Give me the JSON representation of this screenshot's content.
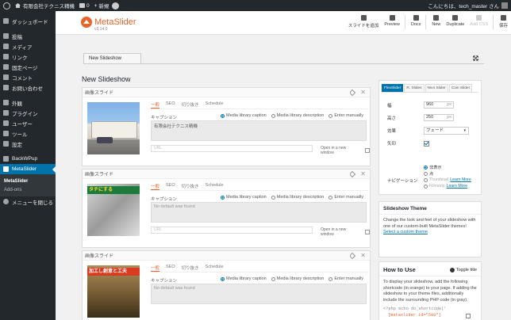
{
  "adminbar": {
    "site_name": "有限会社テクニス精機",
    "comments_count": "0",
    "new_label": "新規",
    "greeting": "こんにちは、tech_master さん"
  },
  "sidebar": {
    "items": [
      {
        "label": "ダッシュボード",
        "icon": "dashboard-icon"
      },
      {
        "label": "投稿",
        "icon": "pushpin-icon"
      },
      {
        "label": "メディア",
        "icon": "media-icon"
      },
      {
        "label": "リンク",
        "icon": "link-icon"
      },
      {
        "label": "固定ページ",
        "icon": "page-icon"
      },
      {
        "label": "コメント",
        "icon": "comment-icon"
      },
      {
        "label": "お問い合わせ",
        "icon": "mail-icon"
      },
      {
        "label": "外観",
        "icon": "brush-icon"
      },
      {
        "label": "プラグイン",
        "icon": "plugin-icon"
      },
      {
        "label": "ユーザー",
        "icon": "user-icon"
      },
      {
        "label": "ツール",
        "icon": "wrench-icon"
      },
      {
        "label": "設定",
        "icon": "settings-icon"
      },
      {
        "label": "BackWPup",
        "icon": "backup-icon"
      },
      {
        "label": "MetaSlider",
        "icon": "slider-icon"
      }
    ],
    "submenu": [
      "MetaSlider",
      "Add-ons"
    ],
    "collapse_label": "メニューを閉じる"
  },
  "header": {
    "logo_name": "MetaSlider",
    "version": "v3.14.0",
    "toolbar": [
      {
        "label": "スライドを追加",
        "icon": "plus-icon"
      },
      {
        "label": "Preview",
        "icon": "eye-icon"
      },
      {
        "label": "Docs",
        "icon": "docs-icon"
      },
      {
        "label": "New",
        "icon": "new-icon"
      },
      {
        "label": "Duplicate",
        "icon": "duplicate-icon"
      },
      {
        "label": "Add CSS",
        "icon": "css-icon"
      },
      {
        "label": "保存",
        "icon": "save-icon"
      }
    ]
  },
  "main": {
    "tab_label": "New Slideshow",
    "page_title": "New Slideshow",
    "slide_tabs": [
      "一般",
      "SEO",
      "切り抜き",
      "Schedule"
    ],
    "caption_label": "キャプション",
    "caption_options": [
      "Media library caption",
      "Media library description",
      "Enter manually"
    ],
    "url_placeholder": "URL",
    "new_window_label": "Open in a new window",
    "slides": [
      {
        "title": "画像スライド",
        "caption": "有限会社テクニス精機",
        "overlay": ""
      },
      {
        "title": "画像スライド",
        "caption": "No default was found",
        "overlay": "タチにする"
      },
      {
        "title": "画像スライド",
        "caption": "No default was found",
        "overlay": "加工し創意と工夫"
      }
    ]
  },
  "settings": {
    "tabs": [
      "FlexSlider",
      "R. Slides",
      "Nivo Slider",
      "Coin Slider"
    ],
    "width_label": "幅",
    "width_value": "960",
    "height_label": "高さ",
    "height_value": "250",
    "unit": "px",
    "effect_label": "効果",
    "effect_value": "フェード",
    "arrows_label": "矢印",
    "navigation_label": "ナビゲーション",
    "nav_options": [
      "非表示",
      "点",
      "Thumbnail",
      "Filmstrip"
    ],
    "learn_more": "Learn More"
  },
  "theme_panel": {
    "title": "Slideshow Theme",
    "body": "Change the look and feel of your slideshow with one of our custom-built MetaSlider themes!",
    "link": "Select a custom theme"
  },
  "howto_panel": {
    "title": "How to Use",
    "toggle": "Toggle title",
    "body": "To display your slideshow, add the following shortcode (in orange) to your page. If adding the slideshow to your theme files, additionally include the surrounding PHP code (in gray).",
    "code_line1": "<?php echo do_shortcode('",
    "code_line2": "[metaslider id=\"500\"]"
  }
}
